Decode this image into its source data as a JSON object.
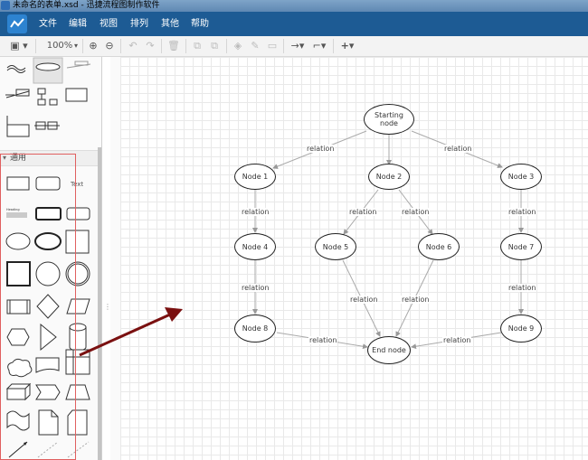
{
  "window": {
    "title": "未命名的表单.xsd - 迅捷流程图制作软件"
  },
  "menu": {
    "items": [
      "文件",
      "编辑",
      "视图",
      "排列",
      "其他",
      "帮助"
    ]
  },
  "toolbar": {
    "zoom": "100%"
  },
  "sidebar": {
    "section_general": "通用",
    "text_shape": "Text",
    "heading_shape": "Heading"
  },
  "diagram": {
    "nodes": {
      "start": "Starting node",
      "n1": "Node 1",
      "n2": "Node 2",
      "n3": "Node 3",
      "n4": "Node 4",
      "n5": "Node 5",
      "n6": "Node 6",
      "n7": "Node 7",
      "n8": "Node 8",
      "n9": "Node 9",
      "end": "End node"
    },
    "edge_label": "relation"
  },
  "colors": {
    "menubar": "#1d5b94",
    "arrow": "#7a1010",
    "guide": "#e06060"
  }
}
